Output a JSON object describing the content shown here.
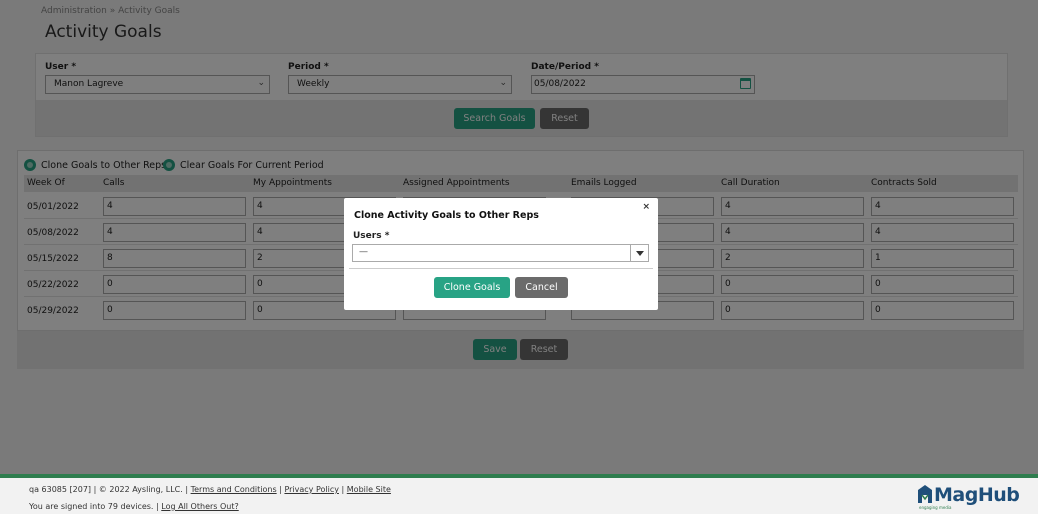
{
  "breadcrumb": {
    "parent": "Administration",
    "separator": "»",
    "current": "Activity Goals"
  },
  "page_title": "Activity Goals",
  "filters": {
    "user_label": "User *",
    "user_value": "Manon Lagreve",
    "period_label": "Period *",
    "period_value": "Weekly",
    "date_label": "Date/Period *",
    "date_value": "05/08/2022",
    "search_button": "Search Goals",
    "reset_button": "Reset"
  },
  "actions": {
    "clone_link": "Clone Goals to Other Reps",
    "clear_link": "Clear Goals For Current Period"
  },
  "table": {
    "headers": [
      "Week Of",
      "Calls",
      "My Appointments",
      "Assigned Appointments",
      "Emails Logged",
      "Call Duration",
      "Contracts Sold"
    ],
    "rows": [
      {
        "week": "05/01/2022",
        "calls": "4",
        "my_appts": "4",
        "call_duration": "4",
        "contracts": "4"
      },
      {
        "week": "05/08/2022",
        "calls": "4",
        "my_appts": "4",
        "call_duration": "4",
        "contracts": "4"
      },
      {
        "week": "05/15/2022",
        "calls": "8",
        "my_appts": "2",
        "call_duration": "2",
        "contracts": "1"
      },
      {
        "week": "05/22/2022",
        "calls": "0",
        "my_appts": "0",
        "call_duration": "0",
        "contracts": "0"
      },
      {
        "week": "05/29/2022",
        "calls": "0",
        "my_appts": "0",
        "call_duration": "0",
        "contracts": "0"
      }
    ]
  },
  "form_buttons": {
    "save": "Save",
    "reset": "Reset"
  },
  "modal": {
    "title": "Clone Activity Goals to Other Reps",
    "close": "×",
    "users_label": "Users *",
    "users_value": "—",
    "clone_button": "Clone Goals",
    "cancel_button": "Cancel"
  },
  "footer": {
    "build": "qa 63085 [207] | © 2022 Aysling, LLC. |",
    "terms": "Terms and Conditions",
    "privacy": "Privacy Policy",
    "mobile": "Mobile Site",
    "signed_in": "You are signed into 79 devices. |",
    "log_out": "Log All Others Out?",
    "sep": "|",
    "logo_text": "MagHub",
    "logo_sub": "engaging media"
  },
  "colors": {
    "accent": "#28a385",
    "gray_button": "#6b6b6b",
    "footer_bar": "#2e7d4e",
    "logo": "#1f4f7a"
  }
}
